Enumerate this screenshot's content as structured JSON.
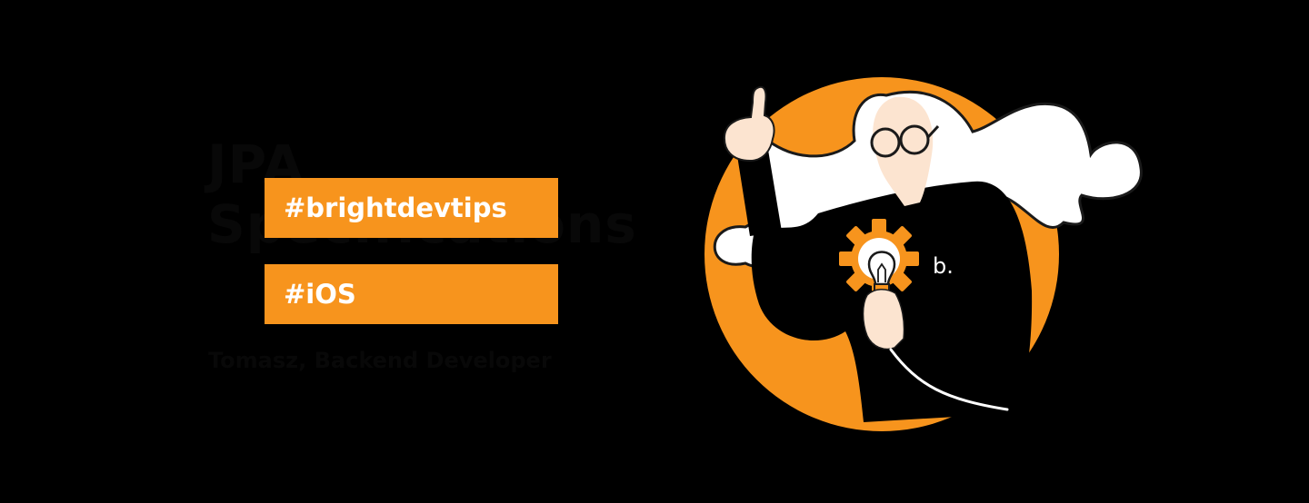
{
  "title": {
    "line1": "JPA",
    "line2": "Specifications"
  },
  "tags": [
    "#brightdevtips",
    "#iOS"
  ],
  "author": "Tomasz, Backend Developer",
  "logo_text": "b.",
  "colors": {
    "background": "#000000",
    "accent": "#F7941D",
    "text_light": "#FFFFFF",
    "title_dim": "#080808"
  },
  "icons": [
    "gear-icon",
    "lightbulb-icon",
    "thumbs-up-gesture"
  ]
}
